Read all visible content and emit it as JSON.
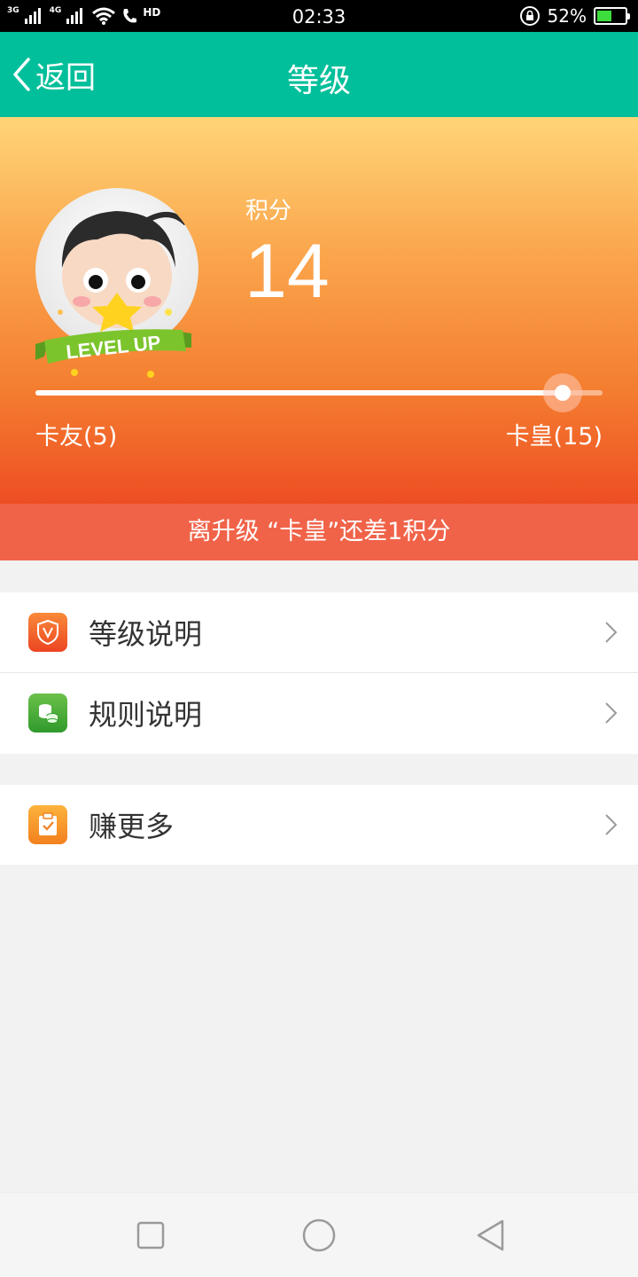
{
  "status_bar": {
    "net1": "3G",
    "net2": "4G",
    "hd": "HD",
    "time": "02:33",
    "battery": "52%",
    "battery_level": 0.52
  },
  "header": {
    "back_label": "返回",
    "title": "等级"
  },
  "hero": {
    "points_label": "积分",
    "points_value": "14",
    "badge_text": "LEVEL UP",
    "progress_fraction": 0.93,
    "current_level_label": "卡友(5)",
    "next_level_label": "卡皇(15)",
    "hint": "离升级 “卡皇”还差1积分"
  },
  "menu": {
    "items": [
      {
        "label": "等级说明",
        "icon": "shield-v-icon",
        "color": "#f0582d"
      },
      {
        "label": "规则说明",
        "icon": "coins-icon",
        "color": "#48a93a"
      },
      {
        "label": "赚更多",
        "icon": "clipboard-check-icon",
        "color": "#f59a2b"
      }
    ]
  },
  "colors": {
    "header_bg": "#00bf9a",
    "hint_bg": "#f06349"
  }
}
